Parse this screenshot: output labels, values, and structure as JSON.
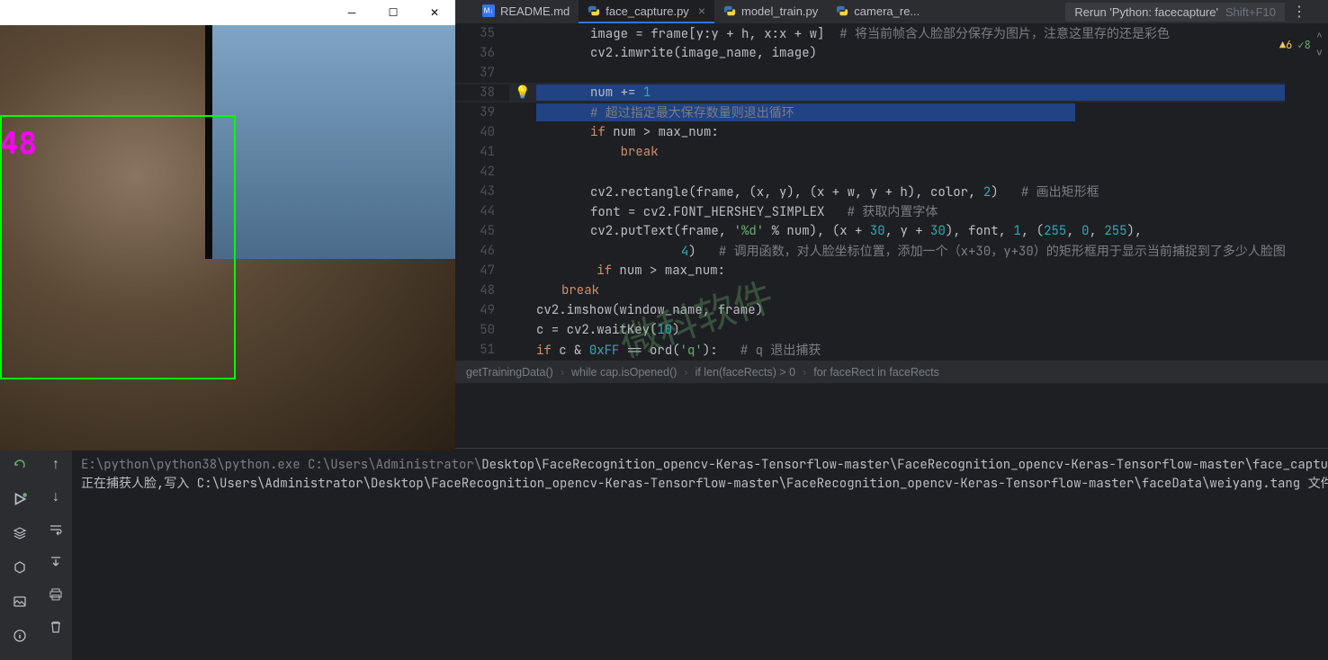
{
  "capture": {
    "counter": "48"
  },
  "tabs": [
    {
      "label": "README.md",
      "active": false,
      "type": "md"
    },
    {
      "label": "face_capture.py",
      "active": true,
      "type": "py",
      "closeable": true
    },
    {
      "label": "model_train.py",
      "active": false,
      "type": "py"
    },
    {
      "label": "camera_re...",
      "active": false,
      "type": "py"
    }
  ],
  "rerun": {
    "label": "Rerun 'Python: facecapture'",
    "shortcut": "Shift+F10"
  },
  "indicators": {
    "warn": "6",
    "ok": "8"
  },
  "breadcrumbs": [
    "getTrainingData()",
    "while cap.isOpened()",
    "if len(faceRects) > 0",
    "for faceRect in faceRects"
  ],
  "lines": {
    "l35": {
      "num": "35",
      "p1": "image = frame[y:y + h, x:x + w]  ",
      "cm": "# 将当前帧含人脸部分保存为图片，注意这里存的还是彩色"
    },
    "l36": {
      "num": "36",
      "p1": "cv2.imwrite(image_name, image)"
    },
    "l37": {
      "num": "37"
    },
    "l38": {
      "num": "38",
      "p1": "num += ",
      "n": "1"
    },
    "l39": {
      "num": "39",
      "cm": "# 超过指定最大保存数量则退出循环"
    },
    "l40": {
      "num": "40",
      "kw": "if",
      "p1": " num > max_num:"
    },
    "l41": {
      "num": "41",
      "kw": "break"
    },
    "l42": {
      "num": "42"
    },
    "l43": {
      "num": "43",
      "p1": "cv2.rectangle(frame, (x, y), (x + w, y + h), color, ",
      "n": "2",
      "p2": ")   ",
      "cm": "# 画出矩形框"
    },
    "l44": {
      "num": "44",
      "p1": "font = cv2.FONT_HERSHEY_SIMPLEX   ",
      "cm": "# 获取内置字体"
    },
    "l45": {
      "num": "45",
      "p1": "cv2.putText(frame, ",
      "s": "'%d'",
      "p2": " % num), (x + ",
      "n1": "30",
      "p3": ", y + ",
      "n2": "30",
      "p4": "), font, ",
      "n3": "1",
      "p5": ", (",
      "n4": "255",
      "c1": ", ",
      "n5": "0",
      "c2": ", ",
      "n6": "255",
      "p6": "),"
    },
    "l46": {
      "num": "46",
      "n": "4",
      "p1": ")   ",
      "cm": "# 调用函数，对人脸坐标位置，添加一个（x+30，y+30）的矩形框用于显示当前捕捉到了多少人脸图"
    },
    "l47": {
      "num": "47",
      "kw": "if",
      "p1": " num > max_num:"
    },
    "l48": {
      "num": "48",
      "kw": "break"
    },
    "l49": {
      "num": "49",
      "p1": "cv2.imshow(window_name, frame)"
    },
    "l50": {
      "num": "50",
      "p1": "c = cv2.waitKey(",
      "n": "10",
      "p2": ")"
    },
    "l51": {
      "num": "51",
      "kw": "if",
      "p1": " c & ",
      "n": "0xFF",
      "p2": " == ord(",
      "s": "'q'",
      "p3": "):   ",
      "cm": "# q 退出捕获"
    }
  },
  "terminal": {
    "l1a": "E:\\python\\python38\\python.exe C:\\Users\\Administrator\\",
    "l1b": "Desktop\\FaceRecognition_opencv-Keras-Tensorflow-master\\FaceRecognition_opencv-Keras-Tensorflow-master\\face_capture",
    "l2": "正在捕获人脸,写入 C:\\Users\\Administrator\\Desktop\\FaceRecognition_opencv-Keras-Tensorflow-master\\FaceRecognition_opencv-Keras-Tensorflow-master\\faceData\\weiyang.tang 文件夹"
  },
  "watermark": "微科软件"
}
